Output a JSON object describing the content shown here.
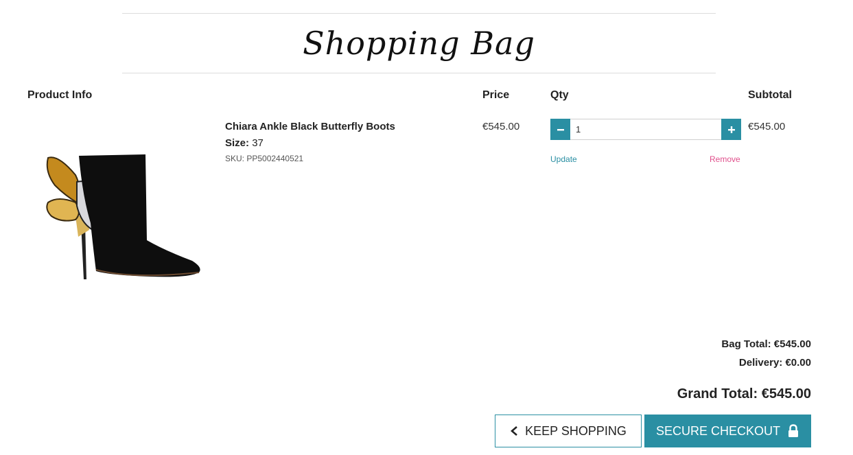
{
  "page": {
    "title": "Shopping Bag"
  },
  "table": {
    "headers": {
      "product_info": "Product Info",
      "price": "Price",
      "qty": "Qty",
      "subtotal": "Subtotal"
    }
  },
  "item": {
    "name": "Chiara Ankle Black Butterfly Boots",
    "size_label": "Size:",
    "size_value": "37",
    "sku": "SKU: PP5002440521",
    "price": "€545.00",
    "quantity": "1",
    "subtotal": "€545.00",
    "update_label": "Update",
    "remove_label": "Remove",
    "image_alt": "black ankle boot with gold and silver butterfly wing heel"
  },
  "totals": {
    "bag_total": "Bag Total: €545.00",
    "delivery": "Delivery: €0.00",
    "grand_total": "Grand Total: €545.00"
  },
  "actions": {
    "keep_shopping": "KEEP SHOPPING",
    "secure_checkout": "SECURE CHECKOUT"
  },
  "icons": {
    "decrement": "minus-icon",
    "increment": "plus-icon",
    "back": "chevron-left-icon",
    "lock": "lock-icon"
  },
  "colors": {
    "accent": "#2a8fa3",
    "remove": "#e0508c"
  }
}
